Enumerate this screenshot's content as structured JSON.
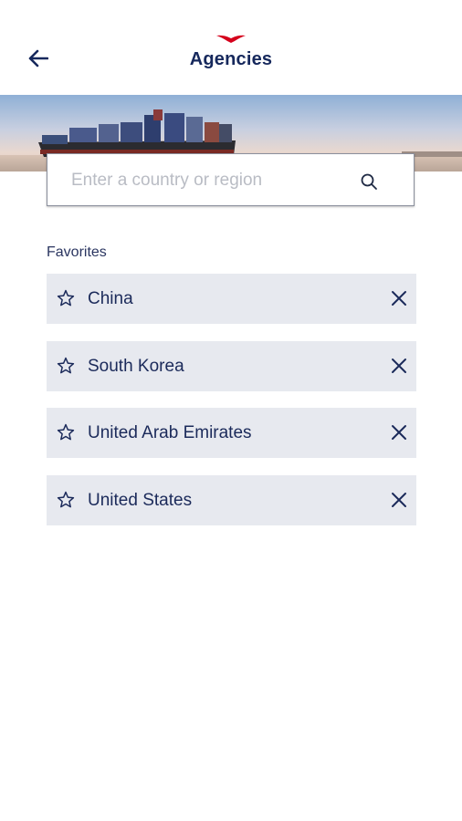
{
  "header": {
    "title": "Agencies",
    "back_icon": "arrow-left-icon",
    "brand_icon": "brand-logo",
    "accent_color": "#d5001c",
    "title_color": "#16285c"
  },
  "search": {
    "placeholder": "Enter a country or region",
    "icon": "search-icon"
  },
  "favorites": {
    "label": "Favorites",
    "items": [
      {
        "name": "China"
      },
      {
        "name": "South Korea"
      },
      {
        "name": "United Arab Emirates"
      },
      {
        "name": "United States"
      }
    ],
    "item_background": "#e7e9ef",
    "star_icon": "star-outline-icon",
    "remove_icon": "close-icon"
  }
}
